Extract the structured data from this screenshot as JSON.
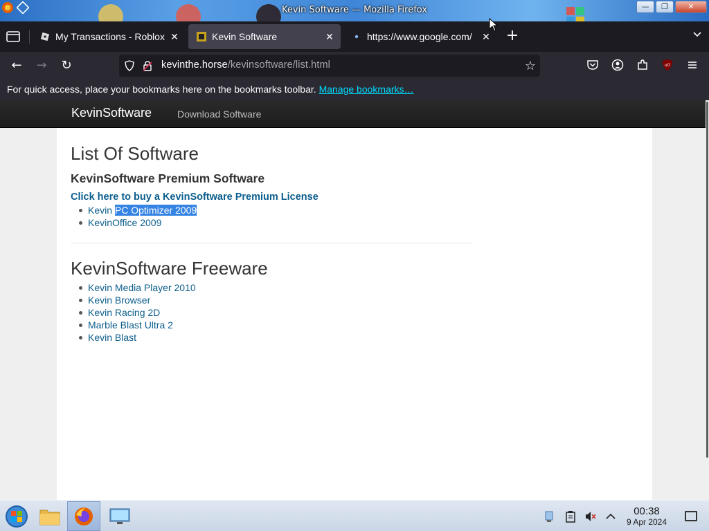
{
  "window": {
    "title": "Kevin Software — Mozilla Firefox",
    "minimize_glyph": "—",
    "maximize_glyph": "❐",
    "close_glyph": "✕"
  },
  "tabs": [
    {
      "label": "My Transactions - Roblox",
      "icon": "roblox-icon",
      "active": false
    },
    {
      "label": "Kevin Software",
      "icon": "kevinsoftware-icon",
      "active": true
    },
    {
      "label": "https://www.google.com/",
      "icon": "loading-dot-icon",
      "active": false
    }
  ],
  "tab_close_glyph": "✕",
  "newtab_glyph": "+",
  "alltabs_glyph": "⌄",
  "nav": {
    "back_glyph": "←",
    "forward_glyph": "→",
    "reload_glyph": "↻",
    "url_host": "kevinthe.horse",
    "url_path": "/kevinsoftware/list.html",
    "star_glyph": "☆"
  },
  "bookmarks": {
    "message": "For quick access, place your bookmarks here on the bookmarks toolbar.",
    "link": "Manage bookmarks…"
  },
  "site": {
    "brand": "KevinSoftware",
    "nav_link": "Download Software",
    "heading": "List Of Software",
    "premium_heading": "KevinSoftware Premium Software",
    "buy_link": "Click here to buy a KevinSoftware Premium License",
    "premium_items": [
      {
        "prefix": "Kevin ",
        "selected": "PC Optimizer 2009"
      },
      {
        "prefix": "KevinOffice 2009",
        "selected": ""
      }
    ],
    "freeware_heading": "KevinSoftware Freeware",
    "freeware_items": [
      "Kevin Media Player 2010",
      "Kevin Browser",
      "Kevin Racing 2D",
      "Marble Blast Ultra 2",
      "Kevin Blast"
    ]
  },
  "taskbar": {
    "time": "00:38",
    "date": "9 Apr 2024"
  },
  "colors": {
    "link": "#0b5d8c",
    "selection": "#3584e4",
    "firefox_dark": "#1c1b22",
    "bookmark_link": "#00ddff"
  }
}
